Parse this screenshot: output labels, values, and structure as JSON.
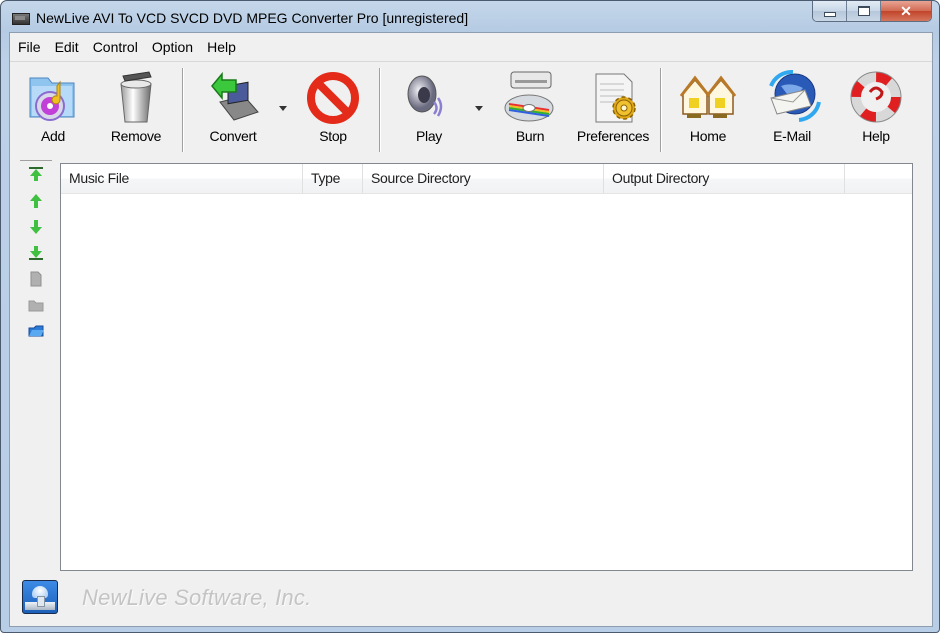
{
  "window": {
    "title": "NewLive AVI To VCD SVCD DVD MPEG Converter Pro  [unregistered]",
    "controls": {
      "minimize": "minimize",
      "maximize": "maximize",
      "close": "✕"
    }
  },
  "menu": [
    "File",
    "Edit",
    "Control",
    "Option",
    "Help"
  ],
  "toolbar": {
    "add": "Add",
    "remove": "Remove",
    "convert": "Convert",
    "stop": "Stop",
    "play": "Play",
    "burn": "Burn",
    "preferences": "Preferences",
    "home": "Home",
    "email": "E-Mail",
    "help": "Help"
  },
  "sidebar": {
    "buttons": [
      "move-to-top",
      "move-up",
      "move-down",
      "move-to-bottom",
      "copy",
      "folder-disabled",
      "open-folder"
    ]
  },
  "list": {
    "columns": [
      "Music File",
      "Type",
      "Source Directory",
      "Output Directory",
      ""
    ],
    "rows": []
  },
  "footer": {
    "company": "NewLive Software, Inc."
  }
}
